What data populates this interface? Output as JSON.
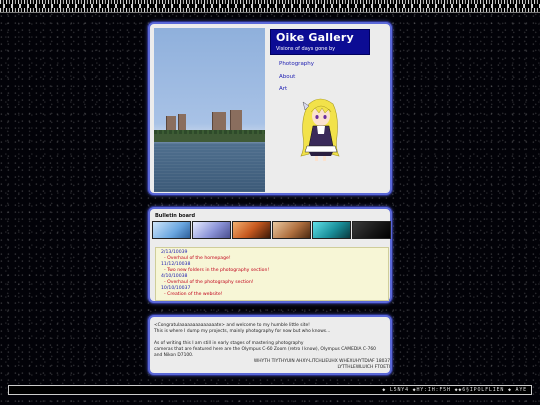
{
  "header": {
    "title": "Oike Gallery",
    "tagline": "Visions of days gone by"
  },
  "nav": {
    "items": [
      {
        "label": "Photography"
      },
      {
        "label": "About"
      },
      {
        "label": "Art"
      }
    ]
  },
  "bulletin": {
    "title": "Bulletin board",
    "banners": [
      {
        "name": "banner-anime-1",
        "color": "#7fb6e8"
      },
      {
        "name": "banner-anime-2",
        "color": "#9aa0d8"
      },
      {
        "name": "banner-anime-3",
        "color": "#c85a20"
      },
      {
        "name": "banner-anime-4",
        "color": "#b07040"
      },
      {
        "name": "banner-anime-5",
        "color": "#1a8f9a"
      },
      {
        "name": "banner-anime-6",
        "color": "#151515"
      }
    ],
    "news": [
      {
        "date": "2/13/10039",
        "item": "- Overhaul of the homepage!"
      },
      {
        "date": "11/12/10038",
        "item": "- Two new folders in the photography section!"
      },
      {
        "date": "4/10/10038",
        "item": "- Overhaul of the photography section!"
      },
      {
        "date": "10/10/10037",
        "item": "- Creation of the website!"
      }
    ]
  },
  "intro": {
    "lines": [
      "<Congratulaaaaaaaaaaaaaate> and welcome to my humble little site!",
      "This is where I dump my projects, mainly photography for now but who knows...",
      "",
      "As of writing this I am still in early stages of mastering photography",
      "cameras that are featured here are the Olympus C-60 Zoom (retro I know), Olympus CAMEDIA C-760",
      "and Nikon D7100."
    ],
    "signature_line1": "WHYTH TIYTHYUIN AHXY-LITCHLIEUHX WHEXUHYTDIAF 18037",
    "signature_line2": "LYTTHLEWLUICH FTOETI"
  },
  "footer": {
    "text": "◆ L5NY4 ◆HY:IH:F5H ◆◆6§IPOLFLIEN ◆ AYE"
  }
}
